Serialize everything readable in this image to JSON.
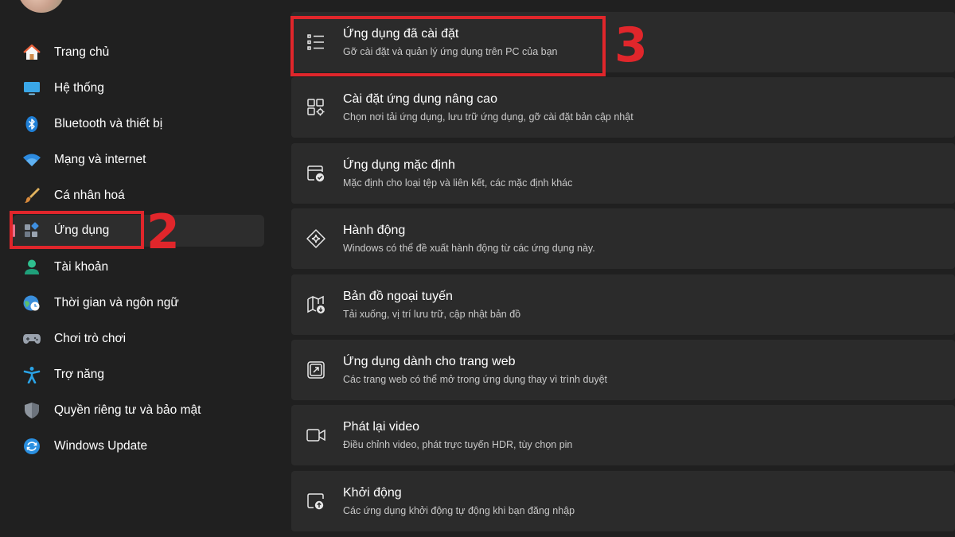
{
  "sidebar": {
    "items": [
      {
        "label": "Trang chủ",
        "icon": "home-icon"
      },
      {
        "label": "Hệ thống",
        "icon": "system-icon"
      },
      {
        "label": "Bluetooth và thiết bị",
        "icon": "bluetooth-icon"
      },
      {
        "label": "Mạng và internet",
        "icon": "wifi-icon"
      },
      {
        "label": "Cá nhân hoá",
        "icon": "paint-brush-icon"
      },
      {
        "label": "Ứng dụng",
        "icon": "apps-icon",
        "active": true
      },
      {
        "label": "Tài khoản",
        "icon": "account-icon"
      },
      {
        "label": "Thời gian và ngôn ngữ",
        "icon": "time-language-icon"
      },
      {
        "label": "Chơi trò chơi",
        "icon": "gamepad-icon"
      },
      {
        "label": "Trợ năng",
        "icon": "accessibility-icon"
      },
      {
        "label": "Quyền riêng tư và bảo mật",
        "icon": "shield-icon"
      },
      {
        "label": "Windows Update",
        "icon": "windows-update-icon"
      }
    ]
  },
  "main": {
    "cards": [
      {
        "title": "Ứng dụng đã cài đặt",
        "desc": "Gỡ cài đặt và quản lý ứng dụng trên PC của bạn",
        "icon": "installed-apps-icon"
      },
      {
        "title": "Cài đặt ứng dụng nâng cao",
        "desc": "Chọn nơi tải ứng dụng, lưu trữ ứng dụng, gỡ cài đặt bản cập nhật",
        "icon": "advanced-app-settings-icon"
      },
      {
        "title": "Ứng dụng mặc định",
        "desc": "Mặc định cho loại tệp và liên kết, các mặc định khác",
        "icon": "default-apps-icon"
      },
      {
        "title": "Hành động",
        "desc": "Windows có thể đề xuất hành động từ các ứng dụng này.",
        "icon": "actions-icon"
      },
      {
        "title": "Bản đồ ngoại tuyến",
        "desc": "Tải xuống, vị trí lưu trữ, cập nhật bản đồ",
        "icon": "offline-maps-icon"
      },
      {
        "title": "Ứng dụng dành cho trang web",
        "desc": "Các trang web có thể mở trong ứng dụng thay vì trình duyệt",
        "icon": "apps-for-websites-icon"
      },
      {
        "title": "Phát lại video",
        "desc": "Điều chỉnh video, phát trực tuyến HDR, tùy chọn pin",
        "icon": "video-playback-icon"
      },
      {
        "title": "Khởi động",
        "desc": "Các ứng dụng khởi động tự động khi bạn đăng nhập",
        "icon": "startup-icon"
      }
    ]
  },
  "annotations": {
    "step2": "2",
    "step3": "3",
    "color": "#e0262b"
  },
  "colors": {
    "background": "#202020",
    "card": "#2b2b2b",
    "active_item": "#2d2d2d",
    "accent_indicator": "#e56f8c"
  }
}
